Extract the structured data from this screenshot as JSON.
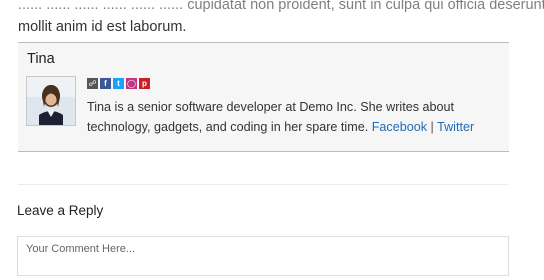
{
  "post": {
    "line1": "...... ...... ...... ...... ...... ...... cupidatat non proident, sunt in culpa qui officia deserunt",
    "line2": "mollit anim id est laborum."
  },
  "author_box": {
    "name": "Tina",
    "bio": "Tina is a senior software developer at Demo Inc. She writes about technology, gadgets, and coding in her spare time.",
    "facebook_label": "Facebook",
    "separator": "|",
    "twitter_label": "Twitter",
    "social_icons": [
      {
        "name": "website-icon",
        "color": "#555555"
      },
      {
        "name": "facebook-icon",
        "color": "#3b5998"
      },
      {
        "name": "twitter-icon",
        "color": "#1da1f2"
      },
      {
        "name": "instagram-icon",
        "color": "#c13584"
      },
      {
        "name": "pinterest-icon",
        "color": "#cb2027"
      }
    ]
  },
  "reply": {
    "title": "Leave a Reply",
    "comment_placeholder": "Your Comment Here..."
  }
}
